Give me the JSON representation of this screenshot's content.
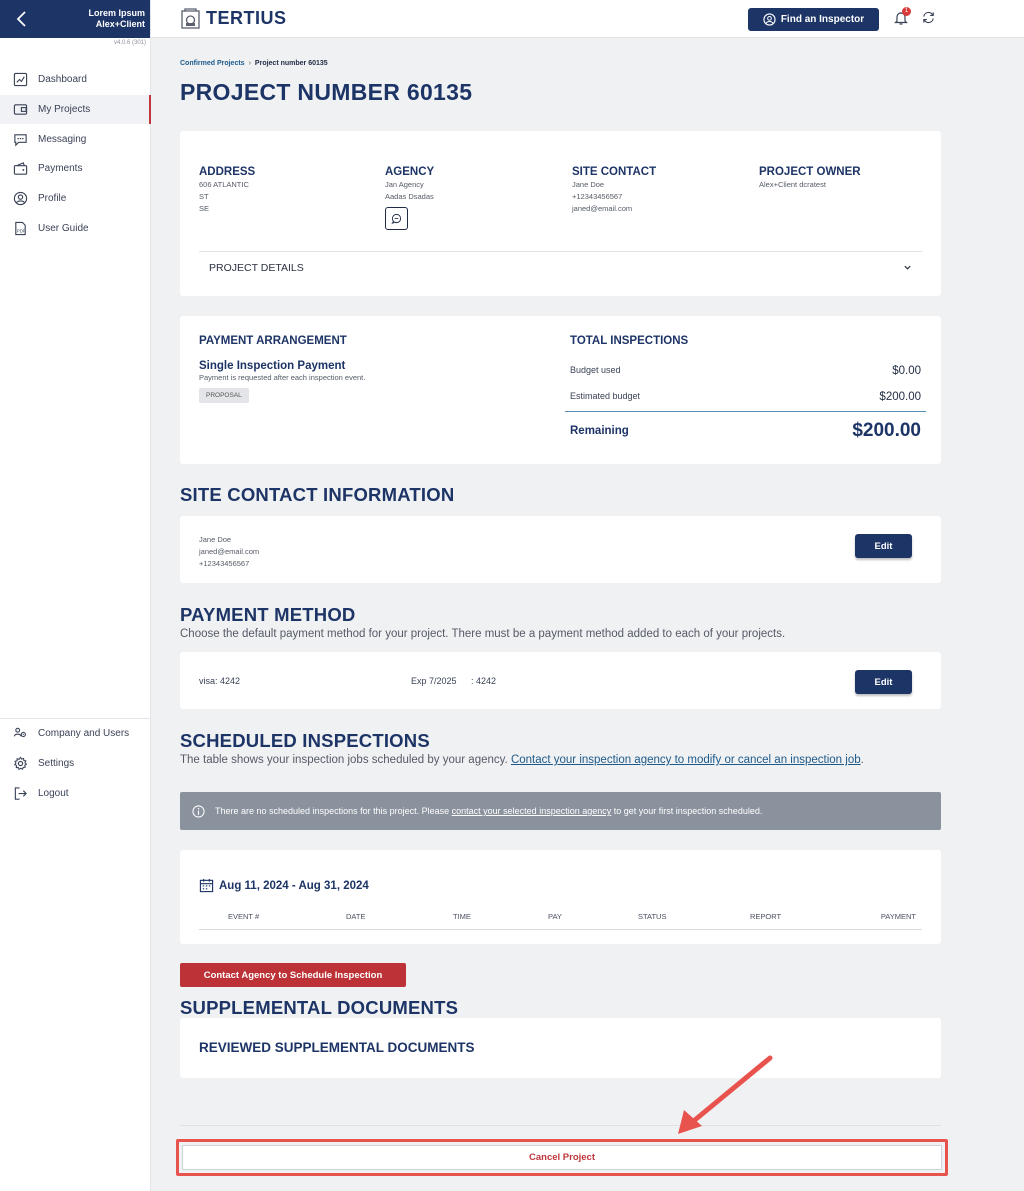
{
  "sidebar": {
    "org_name": "Lorem Ipsum",
    "user_name": "Alex+Client",
    "version": "v4.0.6 (301)",
    "items": [
      {
        "label": "Dashboard",
        "icon": "dashboard-icon"
      },
      {
        "label": "My Projects",
        "icon": "projects-icon",
        "active": true
      },
      {
        "label": "Messaging",
        "icon": "messaging-icon"
      },
      {
        "label": "Payments",
        "icon": "payments-icon"
      },
      {
        "label": "Profile",
        "icon": "profile-icon"
      },
      {
        "label": "User Guide",
        "icon": "pdf-icon"
      }
    ],
    "bottom_items": [
      {
        "label": "Company and Users",
        "icon": "users-icon"
      },
      {
        "label": "Settings",
        "icon": "gear-icon"
      },
      {
        "label": "Logout",
        "icon": "logout-icon"
      }
    ]
  },
  "topbar": {
    "logo": "TERTIUS",
    "find_label": "Find an Inspector",
    "notif_count": "1"
  },
  "breadcrumb": {
    "parent": "Confirmed Projects",
    "current": "Project number 60135"
  },
  "title": "PROJECT NUMBER 60135",
  "info": {
    "address": {
      "heading": "ADDRESS",
      "lines": [
        "606 ATLANTIC",
        "ST",
        "SE"
      ]
    },
    "agency": {
      "heading": "AGENCY",
      "lines": [
        "Jan Agency",
        "Aadas Dsadas"
      ]
    },
    "site_contact": {
      "heading": "SITE CONTACT",
      "lines": [
        "Jane Doe",
        "+12343456567",
        "janed@email.com"
      ]
    },
    "owner": {
      "heading": "PROJECT OWNER",
      "lines": [
        "Alex+Client dcratest"
      ]
    },
    "details_label": "PROJECT DETAILS"
  },
  "payment": {
    "heading": "PAYMENT ARRANGEMENT",
    "type": "Single Inspection Payment",
    "desc": "Payment is requested after each inspection event.",
    "tag": "PROPOSAL",
    "totals_heading": "TOTAL INSPECTIONS",
    "budget_used_label": "Budget used",
    "budget_used": "$0.00",
    "estimated_label": "Estimated budget",
    "estimated": "$200.00",
    "remaining_label": "Remaining",
    "remaining": "$200.00"
  },
  "site_contact_section": {
    "title": "SITE CONTACT INFORMATION",
    "name": "Jane Doe",
    "email": "janed@email.com",
    "phone": "+12343456567",
    "edit": "Edit"
  },
  "payment_method": {
    "title": "PAYMENT METHOD",
    "desc": "Choose the default payment method for your project. There must be a payment method added to each of your projects.",
    "card": "visa: 4242",
    "exp": "Exp 7/2025",
    "last4": ": 4242",
    "edit": "Edit"
  },
  "scheduled": {
    "title": "SCHEDULED INSPECTIONS",
    "desc_prefix": "The table shows your inspection jobs scheduled by your agency. ",
    "desc_link": "Contact your inspection agency to modify or cancel an inspection job",
    "desc_suffix": ".",
    "alert_prefix": "There are no scheduled inspections for this project. Please ",
    "alert_link": "contact your selected inspection agency",
    "alert_suffix": " to get your first inspection scheduled.",
    "date_range": "Aug 11, 2024 - Aug 31, 2024",
    "columns": [
      "EVENT #",
      "DATE",
      "TIME",
      "PAY",
      "STATUS",
      "REPORT",
      "PAYMENT"
    ],
    "contact_button": "Contact Agency to Schedule Inspection"
  },
  "supplemental": {
    "title": "SUPPLEMENTAL DOCUMENTS",
    "reviewed": "REVIEWED SUPPLEMENTAL DOCUMENTS"
  },
  "cancel_label": "Cancel Project",
  "colors": {
    "navy": "#1d3466",
    "red": "#bd3236",
    "highlight": "#e9534d"
  }
}
